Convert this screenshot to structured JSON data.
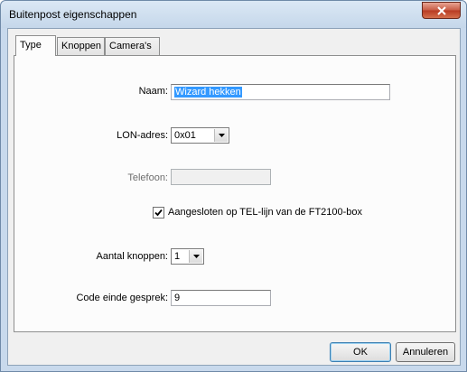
{
  "window": {
    "title": "Buitenpost eigenschappen"
  },
  "tabs": [
    {
      "label": "Type",
      "active": true
    },
    {
      "label": "Knoppen",
      "active": false
    },
    {
      "label": "Camera's",
      "active": false
    }
  ],
  "form": {
    "naam": {
      "label": "Naam:",
      "value": "Wizard hekken"
    },
    "lon_adres": {
      "label": "LON-adres:",
      "value": "0x01"
    },
    "telefoon": {
      "label": "Telefoon:",
      "value": ""
    },
    "aangesloten": {
      "label": "Aangesloten op TEL-lijn van de FT2100-box",
      "checked": true
    },
    "aantal_knoppen": {
      "label": "Aantal knoppen:",
      "value": "1"
    },
    "code_einde": {
      "label": "Code einde gesprek:",
      "value": "9"
    }
  },
  "buttons": {
    "ok": "OK",
    "cancel": "Annuleren"
  },
  "icons": {
    "close": "close-icon",
    "dropdown": "chevron-down-icon",
    "check": "check-icon"
  },
  "colors": {
    "selection": "#3399ff",
    "titlebar": "#c5d7ea",
    "close_button": "#c75a43"
  }
}
